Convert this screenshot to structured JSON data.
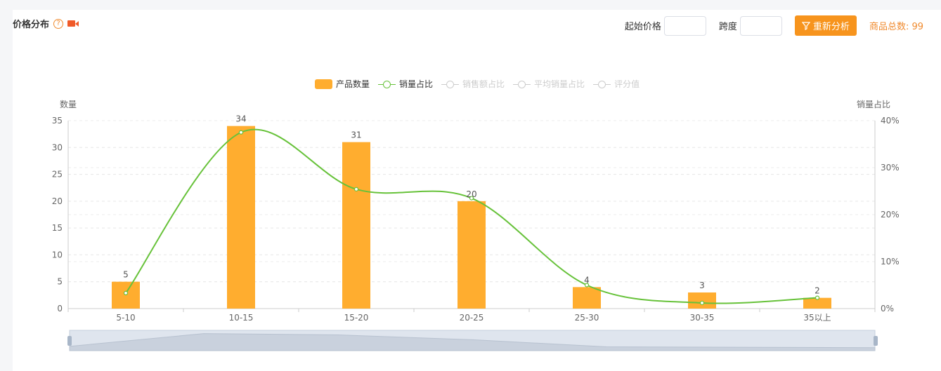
{
  "header": {
    "title": "价格分布",
    "help_icon": "?",
    "start_price_label": "起始价格",
    "start_price_value": "",
    "span_label": "跨度",
    "span_value": "",
    "analyze_button": "重新分析",
    "total_label": "商品总数: 99"
  },
  "colors": {
    "bar": "#ffad2f",
    "line": "#67c23a",
    "accent": "#f7941d",
    "legend_inactive": "#cccccc"
  },
  "legend": {
    "items": [
      {
        "label": "产品数量",
        "active": true
      },
      {
        "label": "销量占比",
        "active": true
      },
      {
        "label": "销售额占比",
        "active": false
      },
      {
        "label": "平均销量占比",
        "active": false
      },
      {
        "label": "评分值",
        "active": false
      }
    ]
  },
  "chart_data": {
    "type": "bar",
    "categories": [
      "5-10",
      "10-15",
      "15-20",
      "20-25",
      "25-30",
      "30-35",
      "35以上"
    ],
    "series": [
      {
        "name": "产品数量",
        "type": "bar",
        "axis": "left",
        "values": [
          5,
          34,
          31,
          20,
          4,
          3,
          2
        ]
      },
      {
        "name": "销量占比",
        "type": "line",
        "axis": "right",
        "smooth": true,
        "values": [
          3.3,
          37.5,
          25.4,
          23.5,
          5.0,
          1.2,
          2.3
        ]
      }
    ],
    "ylabel": "数量",
    "ylabel_right": "销量占比",
    "ylim": [
      0,
      35
    ],
    "yticks": [
      "0",
      "5",
      "10",
      "15",
      "20",
      "25",
      "30",
      "35"
    ],
    "ylim_right": [
      0,
      40
    ],
    "yticks_right": [
      "0%",
      "10%",
      "20%",
      "30%",
      "40%"
    ],
    "grid": true,
    "legend_position": "top-center",
    "datazoom": true
  }
}
